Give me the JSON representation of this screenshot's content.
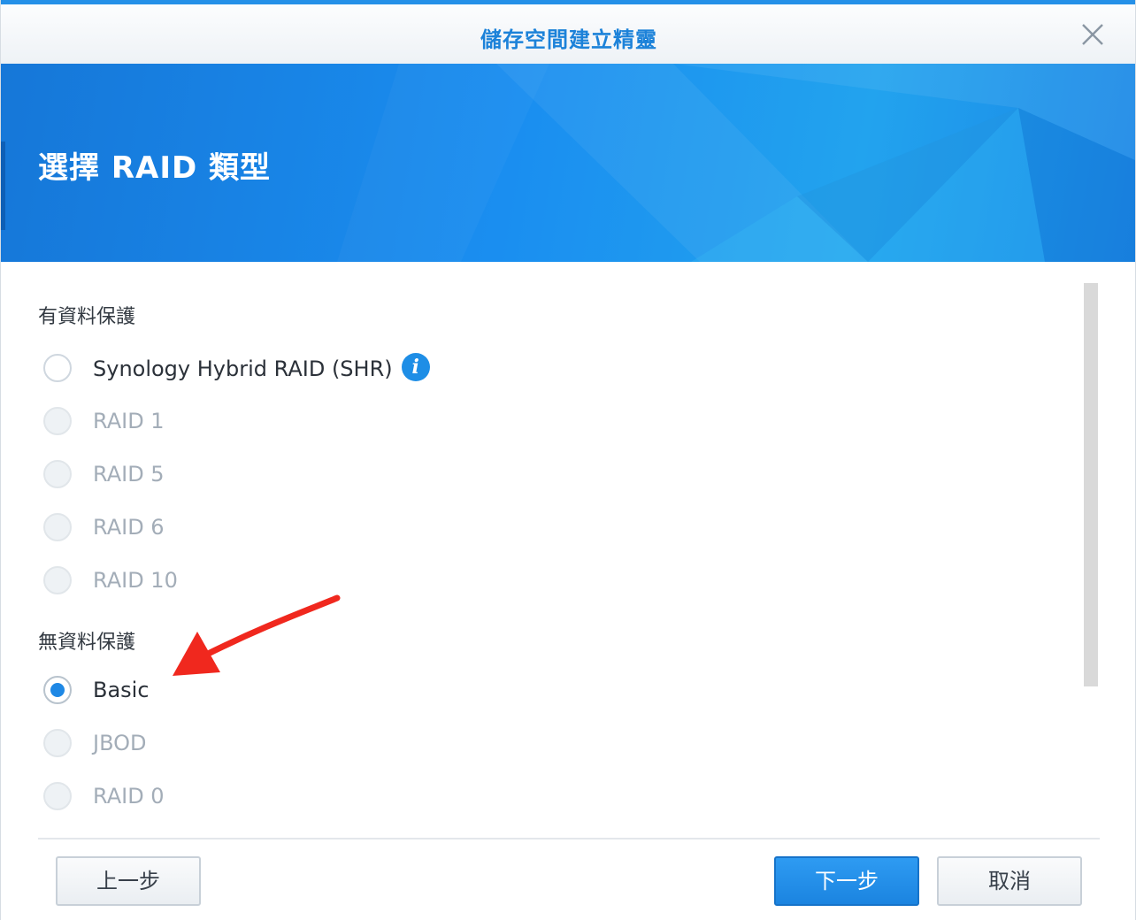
{
  "window": {
    "title": "儲存空間建立精靈",
    "close_icon": "close-icon"
  },
  "banner": {
    "title": "選擇 RAID 類型"
  },
  "sections": [
    {
      "label": "有資料保護",
      "options": [
        {
          "label": "Synology Hybrid RAID (SHR)",
          "state": "enabled",
          "has_info": true
        },
        {
          "label": "RAID 1",
          "state": "disabled"
        },
        {
          "label": "RAID 5",
          "state": "disabled"
        },
        {
          "label": "RAID 6",
          "state": "disabled"
        },
        {
          "label": "RAID 10",
          "state": "disabled"
        }
      ]
    },
    {
      "label": "無資料保護",
      "options": [
        {
          "label": "Basic",
          "state": "selected"
        },
        {
          "label": "JBOD",
          "state": "disabled"
        },
        {
          "label": "RAID 0",
          "state": "disabled"
        }
      ]
    }
  ],
  "info_icon_glyph": "i",
  "footer": {
    "back_label": "上一步",
    "next_label": "下一步",
    "cancel_label": "取消"
  },
  "colors": {
    "accent": "#1e88e5",
    "title_text": "#1c82d9",
    "annotation_arrow": "#f0281e"
  }
}
